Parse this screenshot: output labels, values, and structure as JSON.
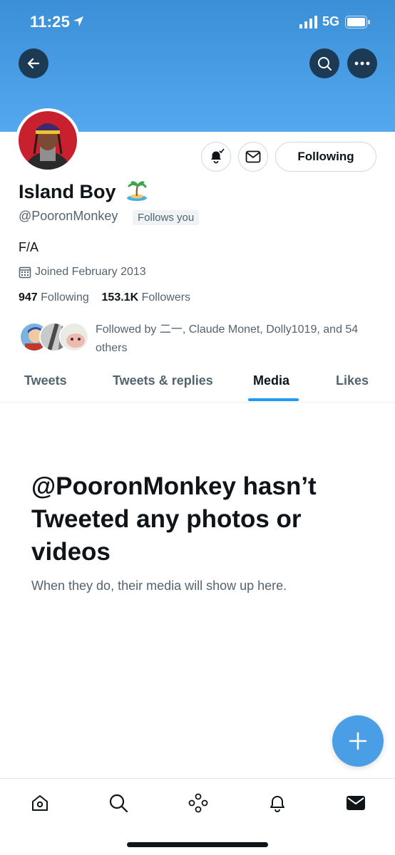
{
  "status_bar": {
    "time": "11:25",
    "network": "5G"
  },
  "header": {
    "back_label": "back",
    "search_label": "search",
    "more_label": "more"
  },
  "profile": {
    "display_name": "Island Boy",
    "handle": "@PooronMonkey",
    "follows_you_badge": "Follows you",
    "bio": "F/A",
    "joined": "Joined February 2013",
    "following_count": "947",
    "following_label": "Following",
    "followers_count": "153.1K",
    "followers_label": "Followers",
    "followed_by_text": "Followed by 二一, Claude Monet, Dolly1019, and 54 others"
  },
  "actions": {
    "following_button": "Following"
  },
  "tabs": [
    {
      "label": "Tweets",
      "active": false
    },
    {
      "label": "Tweets & replies",
      "active": false
    },
    {
      "label": "Media",
      "active": true
    },
    {
      "label": "Likes",
      "active": false
    }
  ],
  "empty_state": {
    "title": "@PooronMonkey hasn’t Tweeted any photos or videos",
    "subtitle": "When they do, their media will show up here."
  },
  "bottom_nav": [
    {
      "icon": "home-icon"
    },
    {
      "icon": "search-icon"
    },
    {
      "icon": "spaces-icon"
    },
    {
      "icon": "notifications-icon"
    },
    {
      "icon": "messages-icon"
    }
  ],
  "colors": {
    "accent": "#1d9bf0",
    "banner": "#4a9ee6",
    "text": "#0f1419",
    "secondary": "#536471"
  }
}
